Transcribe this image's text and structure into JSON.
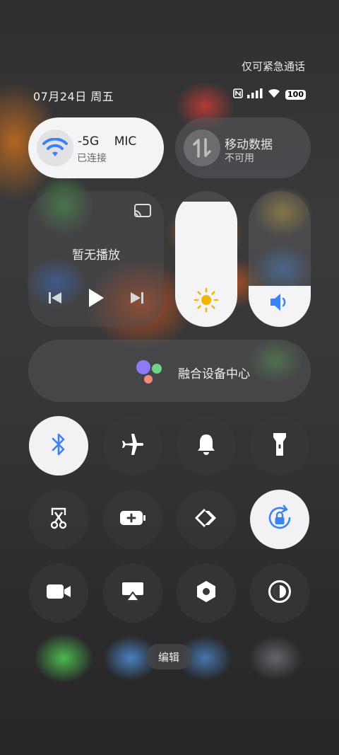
{
  "status_bar": {
    "emergency_text": "仅可紧急通话",
    "date": "07月24日 周五",
    "battery": "100"
  },
  "wifi_tile": {
    "name": "-5G    MIC",
    "status": "已连接"
  },
  "mobile_data_tile": {
    "title": "移动数据",
    "status": "不可用"
  },
  "media_tile": {
    "label": "暂无播放"
  },
  "sliders": {
    "brightness_level": 0.92,
    "volume_level": 0.3
  },
  "device_center": {
    "label": "融合设备中心"
  },
  "toggles": [
    {
      "icon": "bluetooth-icon",
      "on": true
    },
    {
      "icon": "airplane-icon",
      "on": false
    },
    {
      "icon": "bell-icon",
      "on": false
    },
    {
      "icon": "flashlight-icon",
      "on": false
    },
    {
      "icon": "screenshot-scissors-icon",
      "on": false
    },
    {
      "icon": "battery-saver-icon",
      "on": false
    },
    {
      "icon": "nfc-share-icon",
      "on": false
    },
    {
      "icon": "rotation-lock-icon",
      "on": true
    },
    {
      "icon": "video-camera-icon",
      "on": false
    },
    {
      "icon": "screen-cast-icon",
      "on": false
    },
    {
      "icon": "settings-hexagon-icon",
      "on": false
    },
    {
      "icon": "dark-mode-icon",
      "on": false
    }
  ],
  "edit_label": "编辑",
  "colors": {
    "accent_blue": "#3b82f6",
    "sun_yellow": "#f5b400"
  }
}
